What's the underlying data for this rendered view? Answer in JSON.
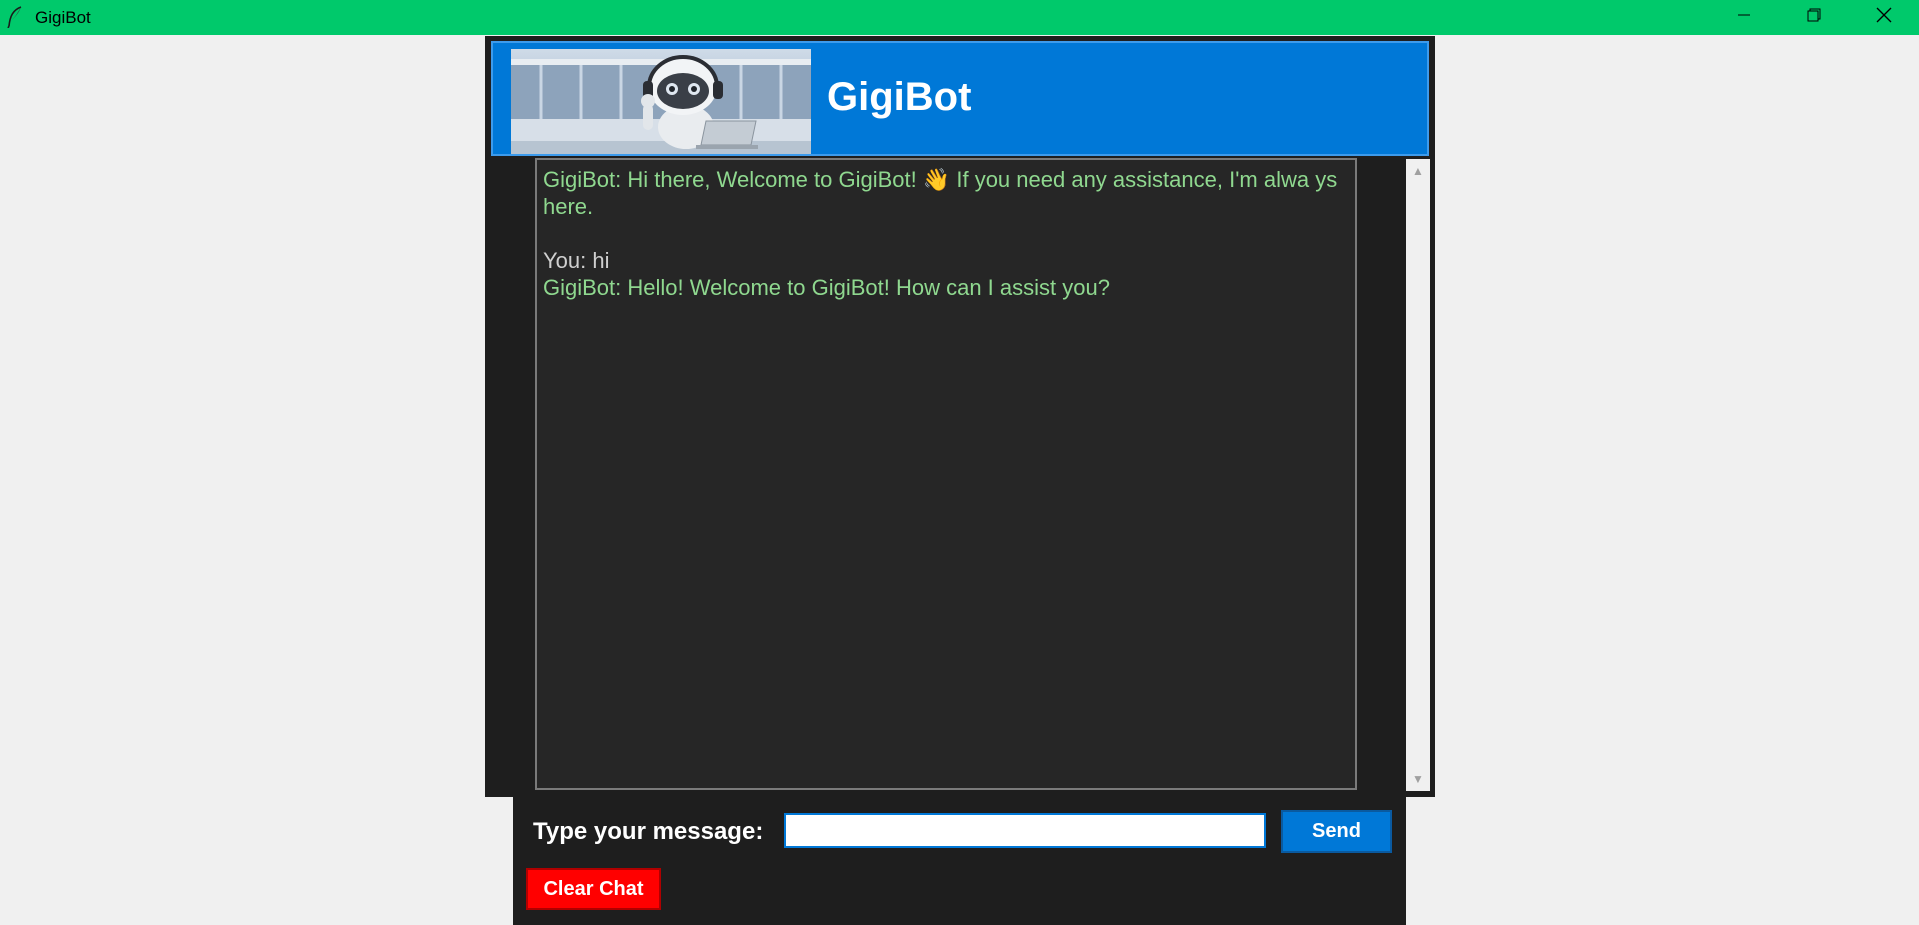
{
  "window": {
    "title": "GigiBot",
    "icon": "feather-icon",
    "controls": [
      "minimize-icon",
      "restore-icon",
      "close-icon"
    ]
  },
  "header": {
    "title": "GigiBot",
    "image": "robot-image"
  },
  "chat": {
    "messages": [
      {
        "sender": "GigiBot",
        "text": "GigiBot: Hi there, Welcome to GigiBot! 👋 If you need any assistance, I'm alwa ys here."
      },
      {
        "sender": "blank",
        "text": ""
      },
      {
        "sender": "You",
        "text": "You: hi"
      },
      {
        "sender": "GigiBot",
        "text": "GigiBot: Hello! Welcome to GigiBot! How can I assist you?"
      }
    ]
  },
  "input": {
    "label": "Type your message:",
    "value": "",
    "placeholder": ""
  },
  "buttons": {
    "send_label": "Send",
    "clear_label": "Clear Chat"
  },
  "colors": {
    "titlebar": "#00c96b",
    "header": "#0078d7",
    "bot_text": "#8fd88f",
    "user_text": "#cfcfcf",
    "chat_bg": "#262626",
    "send_button": "#0078d7",
    "clear_button": "#ff0000"
  }
}
